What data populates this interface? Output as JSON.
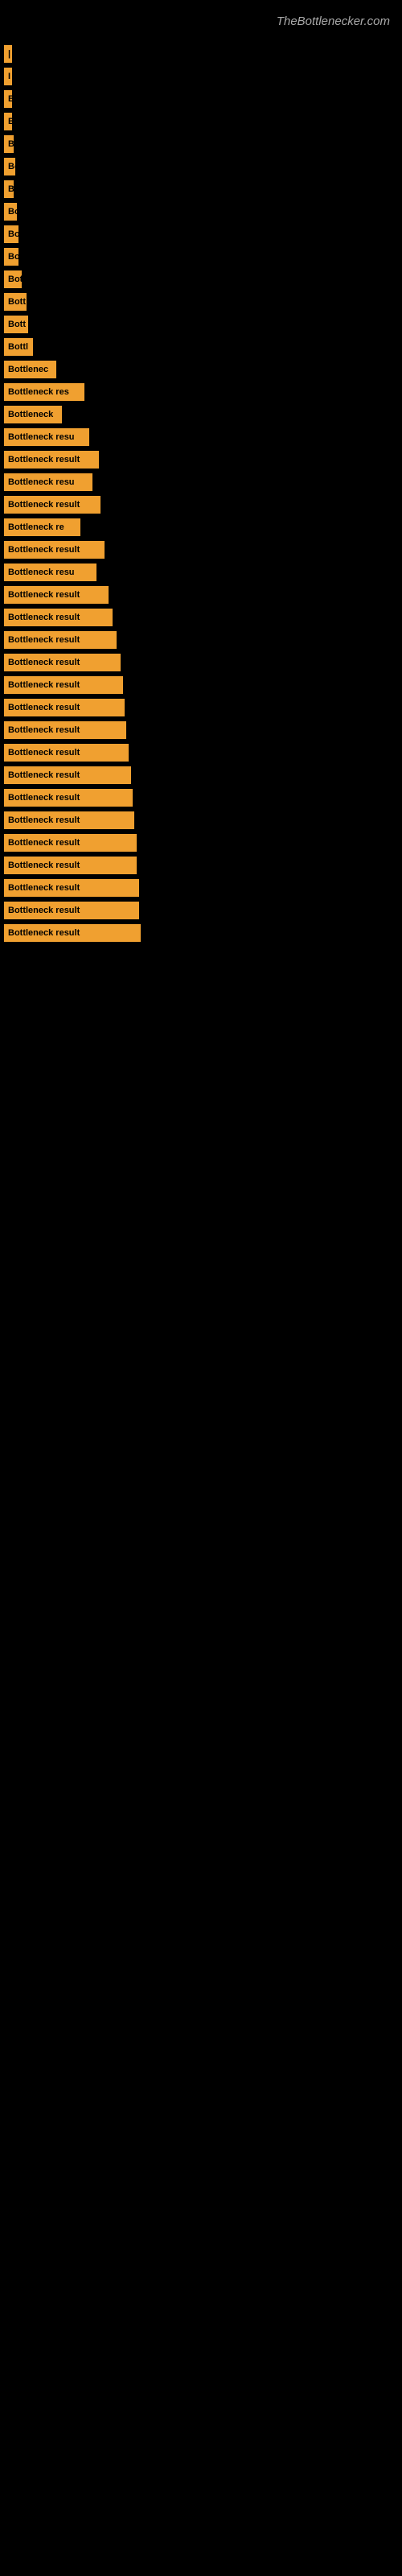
{
  "site": {
    "title": "TheBottlenecker.com"
  },
  "bars": [
    {
      "id": 1,
      "label": "|",
      "width": 8,
      "ext": 0
    },
    {
      "id": 2,
      "label": "I",
      "width": 8,
      "ext": 0
    },
    {
      "id": 3,
      "label": "E",
      "width": 10,
      "ext": 0
    },
    {
      "id": 4,
      "label": "B",
      "width": 10,
      "ext": 0
    },
    {
      "id": 5,
      "label": "B",
      "width": 12,
      "ext": 0
    },
    {
      "id": 6,
      "label": "Bo",
      "width": 14,
      "ext": 0
    },
    {
      "id": 7,
      "label": "B",
      "width": 12,
      "ext": 0
    },
    {
      "id": 8,
      "label": "Bo",
      "width": 16,
      "ext": 0
    },
    {
      "id": 9,
      "label": "Bo",
      "width": 18,
      "ext": 0
    },
    {
      "id": 10,
      "label": "Bo",
      "width": 18,
      "ext": 0
    },
    {
      "id": 11,
      "label": "Bot",
      "width": 22,
      "ext": 0
    },
    {
      "id": 12,
      "label": "Bott",
      "width": 28,
      "ext": 0
    },
    {
      "id": 13,
      "label": "Bott",
      "width": 30,
      "ext": 0
    },
    {
      "id": 14,
      "label": "Bottl",
      "width": 36,
      "ext": 0
    },
    {
      "id": 15,
      "label": "Bottlenec",
      "width": 65,
      "ext": 0
    },
    {
      "id": 16,
      "label": "Bottleneck res",
      "width": 100,
      "ext": 0
    },
    {
      "id": 17,
      "label": "Bottleneck",
      "width": 72,
      "ext": 0
    },
    {
      "id": 18,
      "label": "Bottleneck resu",
      "width": 106,
      "ext": 0
    },
    {
      "id": 19,
      "label": "Bottleneck result",
      "width": 118,
      "ext": 0
    },
    {
      "id": 20,
      "label": "Bottleneck resu",
      "width": 110,
      "ext": 0
    },
    {
      "id": 21,
      "label": "Bottleneck result",
      "width": 120,
      "ext": 0
    },
    {
      "id": 22,
      "label": "Bottleneck re",
      "width": 95,
      "ext": 0
    },
    {
      "id": 23,
      "label": "Bottleneck result",
      "width": 125,
      "ext": 0
    },
    {
      "id": 24,
      "label": "Bottleneck resu",
      "width": 115,
      "ext": 0
    },
    {
      "id": 25,
      "label": "Bottleneck result",
      "width": 130,
      "ext": 0
    },
    {
      "id": 26,
      "label": "Bottleneck result",
      "width": 135,
      "ext": 0
    },
    {
      "id": 27,
      "label": "Bottleneck result",
      "width": 140,
      "ext": 0
    },
    {
      "id": 28,
      "label": "Bottleneck result",
      "width": 145,
      "ext": 0
    },
    {
      "id": 29,
      "label": "Bottleneck result",
      "width": 148,
      "ext": 0
    },
    {
      "id": 30,
      "label": "Bottleneck result",
      "width": 150,
      "ext": 0
    },
    {
      "id": 31,
      "label": "Bottleneck result",
      "width": 152,
      "ext": 0
    },
    {
      "id": 32,
      "label": "Bottleneck result",
      "width": 155,
      "ext": 0
    },
    {
      "id": 33,
      "label": "Bottleneck result",
      "width": 158,
      "ext": 0
    },
    {
      "id": 34,
      "label": "Bottleneck result",
      "width": 160,
      "ext": 0
    },
    {
      "id": 35,
      "label": "Bottleneck result",
      "width": 162,
      "ext": 0
    },
    {
      "id": 36,
      "label": "Bottleneck result",
      "width": 165,
      "ext": 0
    },
    {
      "id": 37,
      "label": "Bottleneck result",
      "width": 165,
      "ext": 0
    },
    {
      "id": 38,
      "label": "Bottleneck result",
      "width": 168,
      "ext": 0
    },
    {
      "id": 39,
      "label": "Bottleneck result",
      "width": 168,
      "ext": 0
    },
    {
      "id": 40,
      "label": "Bottleneck result",
      "width": 170,
      "ext": 0
    }
  ],
  "colors": {
    "bar": "#f0a030",
    "background": "#000000",
    "text_bar": "#000000",
    "title": "#aaaaaa"
  }
}
